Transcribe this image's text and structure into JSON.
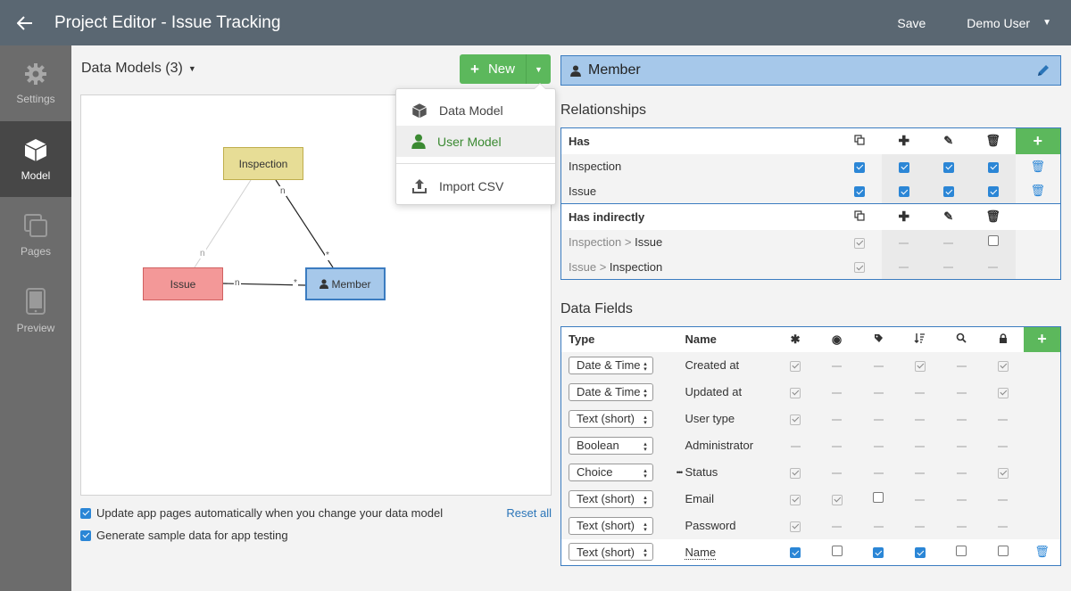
{
  "topbar": {
    "title": "Project Editor - Issue Tracking",
    "save_label": "Save",
    "user_label": "Demo User"
  },
  "sidebar": {
    "items": [
      {
        "label": "Settings",
        "icon": "gear-icon"
      },
      {
        "label": "Model",
        "icon": "cube-icon"
      },
      {
        "label": "Pages",
        "icon": "pages-icon"
      },
      {
        "label": "Preview",
        "icon": "tablet-icon"
      }
    ]
  },
  "models": {
    "header": "Data Models (3)",
    "new_label": "New",
    "entities": {
      "inspection": "Inspection",
      "issue": "Issue",
      "member": "Member"
    },
    "edge_labels": {
      "n1": "n",
      "n2": "n",
      "n3": "n",
      "s1": "*",
      "s2": "*"
    }
  },
  "dropdown": {
    "items": [
      {
        "label": "Data Model",
        "icon": "cube-icon"
      },
      {
        "label": "User Model",
        "icon": "user-icon"
      },
      {
        "label": "Import CSV",
        "icon": "upload-icon"
      }
    ]
  },
  "options": {
    "auto_update": "Update app pages automatically when you change your data model",
    "sample_data": "Generate sample data for app testing",
    "reset": "Reset all"
  },
  "member_panel": {
    "title": "Member",
    "relationships_title": "Relationships",
    "has_label": "Has",
    "has_rows": [
      "Inspection",
      "Issue"
    ],
    "has_indirectly_label": "Has indirectly",
    "indirect_rows": [
      {
        "from": "Inspection",
        "to": "Issue"
      },
      {
        "from": "Issue",
        "to": "Inspection"
      }
    ],
    "sep": ">",
    "data_fields_title": "Data Fields",
    "type_header": "Type",
    "name_header": "Name",
    "fields": [
      {
        "type": "Date & Time",
        "name": "Created at"
      },
      {
        "type": "Date & Time",
        "name": "Updated at"
      },
      {
        "type": "Text (short)",
        "name": "User type"
      },
      {
        "type": "Boolean",
        "name": "Administrator"
      },
      {
        "type": "Choice",
        "name": "Status",
        "more": "•••"
      },
      {
        "type": "Text (short)",
        "name": "Email"
      },
      {
        "type": "Text (short)",
        "name": "Password"
      },
      {
        "type": "Text (short)",
        "name": "Name"
      }
    ]
  },
  "colors": {
    "topbar": "#5a6772",
    "sidebar": "#6c6c6c",
    "accent_green": "#5cb85c",
    "member_blue": "#a6c8ea",
    "link_blue": "#2b75b8"
  }
}
